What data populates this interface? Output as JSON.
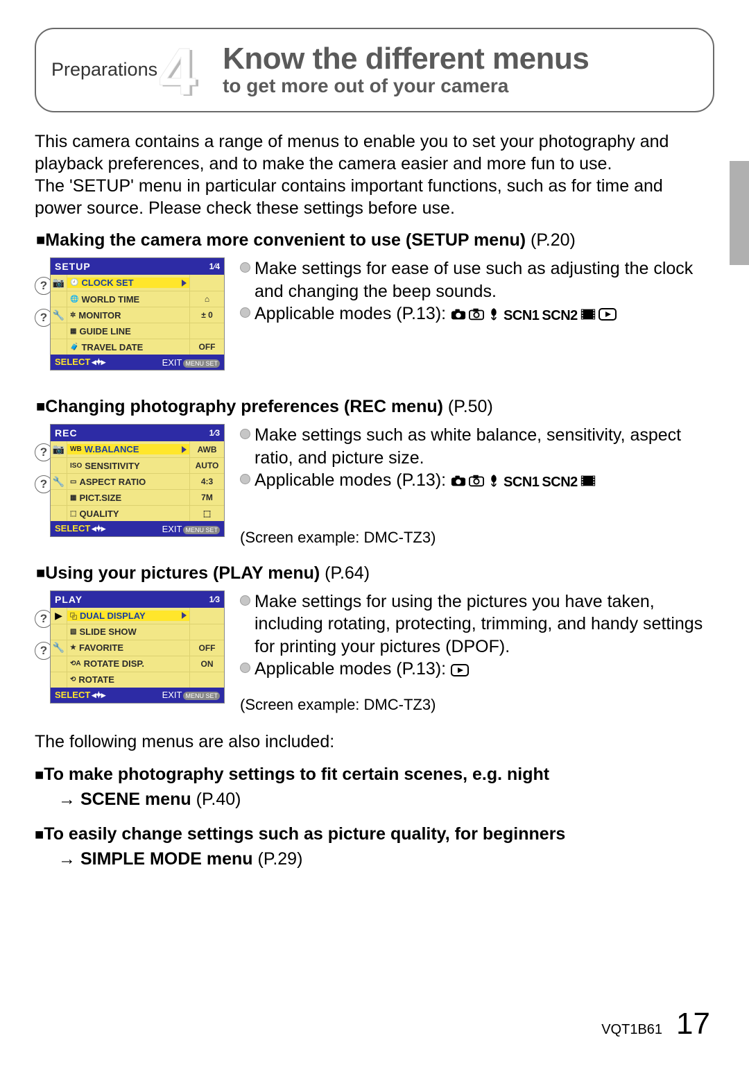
{
  "header": {
    "prep_label": "Preparations",
    "number": "4",
    "title": "Know the different menus",
    "subtitle": "to get more out of your camera"
  },
  "intro": "This camera contains a range of menus to enable you to set your photography and playback preferences, and to make the camera easier and more fun to use.\nThe 'SETUP' menu in particular contains important functions, such as for time and power source. Please check these settings before use.",
  "sections": {
    "setup": {
      "heading_bold": "Making the camera more convenient to use (SETUP menu)",
      "heading_pref": " (P.20)",
      "bullets": [
        "Make settings for ease of use such as adjusting the clock and changing the beep sounds.",
        "Applicable modes (P.13): "
      ],
      "modes": [
        "camera",
        "simple",
        "macro",
        "scn1",
        "scn2",
        "movie",
        "play"
      ],
      "menu": {
        "kind": "camera-menu",
        "title": "SETUP",
        "page": "1/4",
        "left_icons": [
          "camera",
          "",
          "wrench",
          "",
          ""
        ],
        "rows": [
          {
            "icon": "clock",
            "label": "CLOCK SET",
            "value": "",
            "highlight": true,
            "arrow": true
          },
          {
            "icon": "globe",
            "label": "WORLD TIME",
            "value": "⌂"
          },
          {
            "icon": "bright",
            "label": "MONITOR",
            "value": "± 0"
          },
          {
            "icon": "grid",
            "label": "GUIDE LINE",
            "value": ""
          },
          {
            "icon": "suitcase",
            "label": "TRAVEL DATE",
            "value": "OFF"
          }
        ],
        "footer": {
          "select": "SELECT",
          "exit": "EXIT",
          "btn": "MENU SET"
        }
      }
    },
    "rec": {
      "heading_bold": "Changing photography preferences (REC menu)",
      "heading_pref": " (P.50)",
      "bullets": [
        "Make settings such as white balance, sensitivity, aspect ratio, and picture size.",
        "Applicable modes (P.13): "
      ],
      "modes": [
        "camera",
        "simple",
        "macro",
        "scn1",
        "scn2",
        "movie"
      ],
      "screen_note": "(Screen example: DMC-TZ3)",
      "menu": {
        "kind": "camera-menu",
        "title": "REC",
        "page": "1/3",
        "left_icons": [
          "camera",
          "",
          "wrench",
          "",
          ""
        ],
        "rows": [
          {
            "icon": "wb",
            "label": "W.BALANCE",
            "value": "AWB",
            "highlight": true,
            "arrow": true
          },
          {
            "icon": "iso",
            "label": "SENSITIVITY",
            "value": "AUTO"
          },
          {
            "icon": "aspect",
            "label": "ASPECT RATIO",
            "value": "4:3"
          },
          {
            "icon": "pict",
            "label": "PICT.SIZE",
            "value": "7M"
          },
          {
            "icon": "qual",
            "label": "QUALITY",
            "value": "⬚"
          }
        ],
        "footer": {
          "select": "SELECT",
          "exit": "EXIT",
          "btn": "MENU SET"
        }
      }
    },
    "play": {
      "heading_bold": "Using your pictures (PLAY menu)",
      "heading_pref": " (P.64)",
      "bullets": [
        "Make settings for using the pictures you have taken, including rotating, protecting, trimming, and handy settings for printing your pictures (DPOF).",
        "Applicable modes (P.13): "
      ],
      "modes": [
        "play"
      ],
      "screen_note": "(Screen example: DMC-TZ3)",
      "menu": {
        "kind": "camera-menu",
        "title": "PLAY",
        "page": "1/3",
        "left_icons": [
          "play",
          "",
          "wrench",
          "",
          ""
        ],
        "rows": [
          {
            "icon": "dual",
            "label": "DUAL DISPLAY",
            "value": "",
            "highlight": true,
            "arrow": true
          },
          {
            "icon": "slide",
            "label": "SLIDE SHOW",
            "value": ""
          },
          {
            "icon": "star",
            "label": "FAVORITE",
            "value": "OFF"
          },
          {
            "icon": "rotdisp",
            "label": "ROTATE DISP.",
            "value": "ON"
          },
          {
            "icon": "rotate",
            "label": "ROTATE",
            "value": ""
          }
        ],
        "footer": {
          "select": "SELECT",
          "exit": "EXIT",
          "btn": "MENU SET"
        }
      }
    }
  },
  "later_intro": "The following menus are also included:",
  "later": [
    {
      "heading": "To make photography settings to fit certain scenes, e.g. night",
      "arrow": "→ SCENE menu",
      "pref": " (P.40)"
    },
    {
      "heading": "To easily change settings such as picture quality, for beginners",
      "arrow": "→ SIMPLE MODE menu",
      "pref": " (P.29)"
    }
  ],
  "footer": {
    "code": "VQT1B61",
    "page": "17"
  },
  "tooltip_char": "?"
}
